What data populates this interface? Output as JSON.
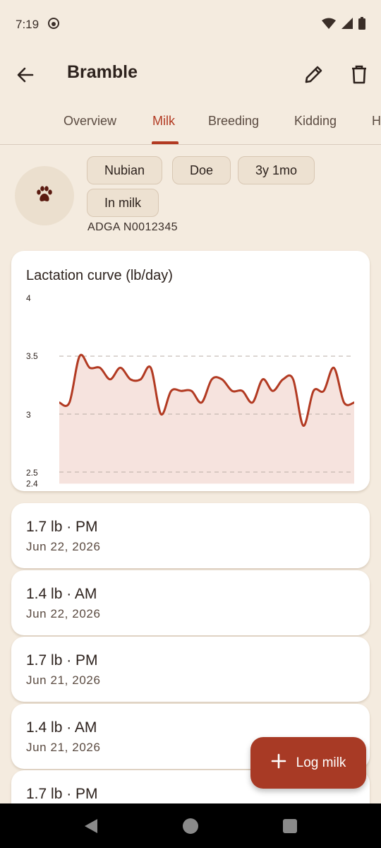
{
  "status_bar": {
    "time": "7:19"
  },
  "app_bar": {
    "title": "Bramble"
  },
  "tabs": [
    {
      "label": "Overview"
    },
    {
      "label": "Milk"
    },
    {
      "label": "Breeding"
    },
    {
      "label": "Kidding"
    },
    {
      "label": "H"
    }
  ],
  "profile": {
    "chips": [
      "Nubian",
      "Doe",
      "3y 1mo",
      "In milk"
    ],
    "registration": "ADGA N0012345"
  },
  "chart": {
    "title": "Lactation curve (lb/day)"
  },
  "chart_data": {
    "type": "area",
    "title": "Lactation curve (lb/day)",
    "y_ticks": [
      "4",
      "3.5",
      "3",
      "2.5",
      "2.4"
    ],
    "ylim": [
      2.4,
      4
    ],
    "grid": "dashed horizontal at 2.5, 3, 3.5",
    "series": [
      {
        "values": [
          3.1,
          3.1,
          3.5,
          3.4,
          3.4,
          3.3,
          3.4,
          3.3,
          3.3,
          3.4,
          3.0,
          3.2,
          3.2,
          3.2,
          3.1,
          3.3,
          3.3,
          3.2,
          3.2,
          3.1,
          3.3,
          3.2,
          3.3,
          3.3,
          2.9,
          3.2,
          3.2,
          3.4,
          3.1,
          3.1
        ]
      }
    ],
    "colors": {
      "line": "#b23a22",
      "fill": "#f6e3de"
    }
  },
  "entries": [
    {
      "amount": "1.7 lb · PM",
      "date": "Jun 22, 2026"
    },
    {
      "amount": "1.4 lb · AM",
      "date": "Jun 22, 2026"
    },
    {
      "amount": "1.7 lb · PM",
      "date": "Jun 21, 2026"
    },
    {
      "amount": "1.4 lb · AM",
      "date": "Jun 21, 2026"
    },
    {
      "amount": "1.7 lb · PM",
      "date": ""
    }
  ],
  "fab": {
    "label": "Log milk"
  },
  "theme": {
    "accent": "#b23a22",
    "background": "#f4ebdf"
  }
}
